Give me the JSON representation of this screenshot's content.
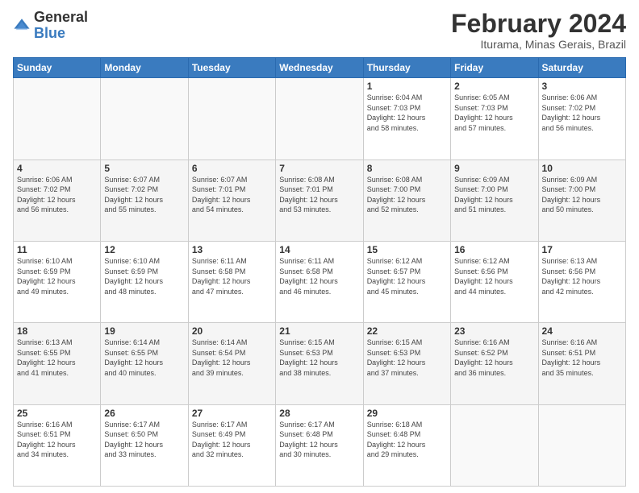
{
  "header": {
    "logo_general": "General",
    "logo_blue": "Blue",
    "month_title": "February 2024",
    "location": "Iturama, Minas Gerais, Brazil"
  },
  "days_of_week": [
    "Sunday",
    "Monday",
    "Tuesday",
    "Wednesday",
    "Thursday",
    "Friday",
    "Saturday"
  ],
  "weeks": [
    [
      {
        "day": "",
        "info": ""
      },
      {
        "day": "",
        "info": ""
      },
      {
        "day": "",
        "info": ""
      },
      {
        "day": "",
        "info": ""
      },
      {
        "day": "1",
        "info": "Sunrise: 6:04 AM\nSunset: 7:03 PM\nDaylight: 12 hours\nand 58 minutes."
      },
      {
        "day": "2",
        "info": "Sunrise: 6:05 AM\nSunset: 7:03 PM\nDaylight: 12 hours\nand 57 minutes."
      },
      {
        "day": "3",
        "info": "Sunrise: 6:06 AM\nSunset: 7:02 PM\nDaylight: 12 hours\nand 56 minutes."
      }
    ],
    [
      {
        "day": "4",
        "info": "Sunrise: 6:06 AM\nSunset: 7:02 PM\nDaylight: 12 hours\nand 56 minutes."
      },
      {
        "day": "5",
        "info": "Sunrise: 6:07 AM\nSunset: 7:02 PM\nDaylight: 12 hours\nand 55 minutes."
      },
      {
        "day": "6",
        "info": "Sunrise: 6:07 AM\nSunset: 7:01 PM\nDaylight: 12 hours\nand 54 minutes."
      },
      {
        "day": "7",
        "info": "Sunrise: 6:08 AM\nSunset: 7:01 PM\nDaylight: 12 hours\nand 53 minutes."
      },
      {
        "day": "8",
        "info": "Sunrise: 6:08 AM\nSunset: 7:00 PM\nDaylight: 12 hours\nand 52 minutes."
      },
      {
        "day": "9",
        "info": "Sunrise: 6:09 AM\nSunset: 7:00 PM\nDaylight: 12 hours\nand 51 minutes."
      },
      {
        "day": "10",
        "info": "Sunrise: 6:09 AM\nSunset: 7:00 PM\nDaylight: 12 hours\nand 50 minutes."
      }
    ],
    [
      {
        "day": "11",
        "info": "Sunrise: 6:10 AM\nSunset: 6:59 PM\nDaylight: 12 hours\nand 49 minutes."
      },
      {
        "day": "12",
        "info": "Sunrise: 6:10 AM\nSunset: 6:59 PM\nDaylight: 12 hours\nand 48 minutes."
      },
      {
        "day": "13",
        "info": "Sunrise: 6:11 AM\nSunset: 6:58 PM\nDaylight: 12 hours\nand 47 minutes."
      },
      {
        "day": "14",
        "info": "Sunrise: 6:11 AM\nSunset: 6:58 PM\nDaylight: 12 hours\nand 46 minutes."
      },
      {
        "day": "15",
        "info": "Sunrise: 6:12 AM\nSunset: 6:57 PM\nDaylight: 12 hours\nand 45 minutes."
      },
      {
        "day": "16",
        "info": "Sunrise: 6:12 AM\nSunset: 6:56 PM\nDaylight: 12 hours\nand 44 minutes."
      },
      {
        "day": "17",
        "info": "Sunrise: 6:13 AM\nSunset: 6:56 PM\nDaylight: 12 hours\nand 42 minutes."
      }
    ],
    [
      {
        "day": "18",
        "info": "Sunrise: 6:13 AM\nSunset: 6:55 PM\nDaylight: 12 hours\nand 41 minutes."
      },
      {
        "day": "19",
        "info": "Sunrise: 6:14 AM\nSunset: 6:55 PM\nDaylight: 12 hours\nand 40 minutes."
      },
      {
        "day": "20",
        "info": "Sunrise: 6:14 AM\nSunset: 6:54 PM\nDaylight: 12 hours\nand 39 minutes."
      },
      {
        "day": "21",
        "info": "Sunrise: 6:15 AM\nSunset: 6:53 PM\nDaylight: 12 hours\nand 38 minutes."
      },
      {
        "day": "22",
        "info": "Sunrise: 6:15 AM\nSunset: 6:53 PM\nDaylight: 12 hours\nand 37 minutes."
      },
      {
        "day": "23",
        "info": "Sunrise: 6:16 AM\nSunset: 6:52 PM\nDaylight: 12 hours\nand 36 minutes."
      },
      {
        "day": "24",
        "info": "Sunrise: 6:16 AM\nSunset: 6:51 PM\nDaylight: 12 hours\nand 35 minutes."
      }
    ],
    [
      {
        "day": "25",
        "info": "Sunrise: 6:16 AM\nSunset: 6:51 PM\nDaylight: 12 hours\nand 34 minutes."
      },
      {
        "day": "26",
        "info": "Sunrise: 6:17 AM\nSunset: 6:50 PM\nDaylight: 12 hours\nand 33 minutes."
      },
      {
        "day": "27",
        "info": "Sunrise: 6:17 AM\nSunset: 6:49 PM\nDaylight: 12 hours\nand 32 minutes."
      },
      {
        "day": "28",
        "info": "Sunrise: 6:17 AM\nSunset: 6:48 PM\nDaylight: 12 hours\nand 30 minutes."
      },
      {
        "day": "29",
        "info": "Sunrise: 6:18 AM\nSunset: 6:48 PM\nDaylight: 12 hours\nand 29 minutes."
      },
      {
        "day": "",
        "info": ""
      },
      {
        "day": "",
        "info": ""
      }
    ]
  ]
}
